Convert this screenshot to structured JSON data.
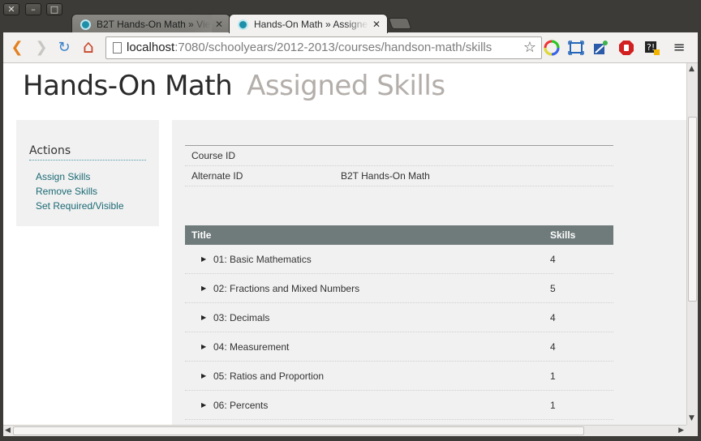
{
  "window_controls": {
    "close": "✕",
    "minimize": "–",
    "maximize": "□"
  },
  "tabs": [
    {
      "label": "B2T Hands-On Math » Vie",
      "active": false
    },
    {
      "label": "Hands-On Math » Assigne",
      "active": true
    }
  ],
  "toolbar": {
    "back": "❮",
    "forward": "❯",
    "reload": "↻",
    "home": "⌂",
    "url_host": "localhost",
    "url_rest": ":7080/schoolyears/2012-2013/courses/handson-math/skills",
    "star": "☆"
  },
  "page": {
    "course_title": "Hands-On Math",
    "subtitle": "Assigned Skills"
  },
  "sidebar": {
    "heading": "Actions",
    "links": [
      "Assign Skills",
      "Remove Skills",
      "Set Required/Visible"
    ]
  },
  "info": {
    "rows": [
      {
        "label": "Course ID",
        "value": ""
      },
      {
        "label": "Alternate ID",
        "value": "B2T Hands-On Math"
      }
    ]
  },
  "table": {
    "headers": {
      "title": "Title",
      "skills": "Skills"
    },
    "rows": [
      {
        "title": "01: Basic Mathematics",
        "skills": "4"
      },
      {
        "title": "02: Fractions and Mixed Numbers",
        "skills": "5"
      },
      {
        "title": "03: Decimals",
        "skills": "4"
      },
      {
        "title": "04: Measurement",
        "skills": "4"
      },
      {
        "title": "05: Ratios and Proportion",
        "skills": "1"
      },
      {
        "title": "06: Percents",
        "skills": "1"
      }
    ]
  },
  "colors": {
    "link": "#1b6a74",
    "table_header": "#6f7a7b",
    "subtitle": "#b3aeaa"
  }
}
